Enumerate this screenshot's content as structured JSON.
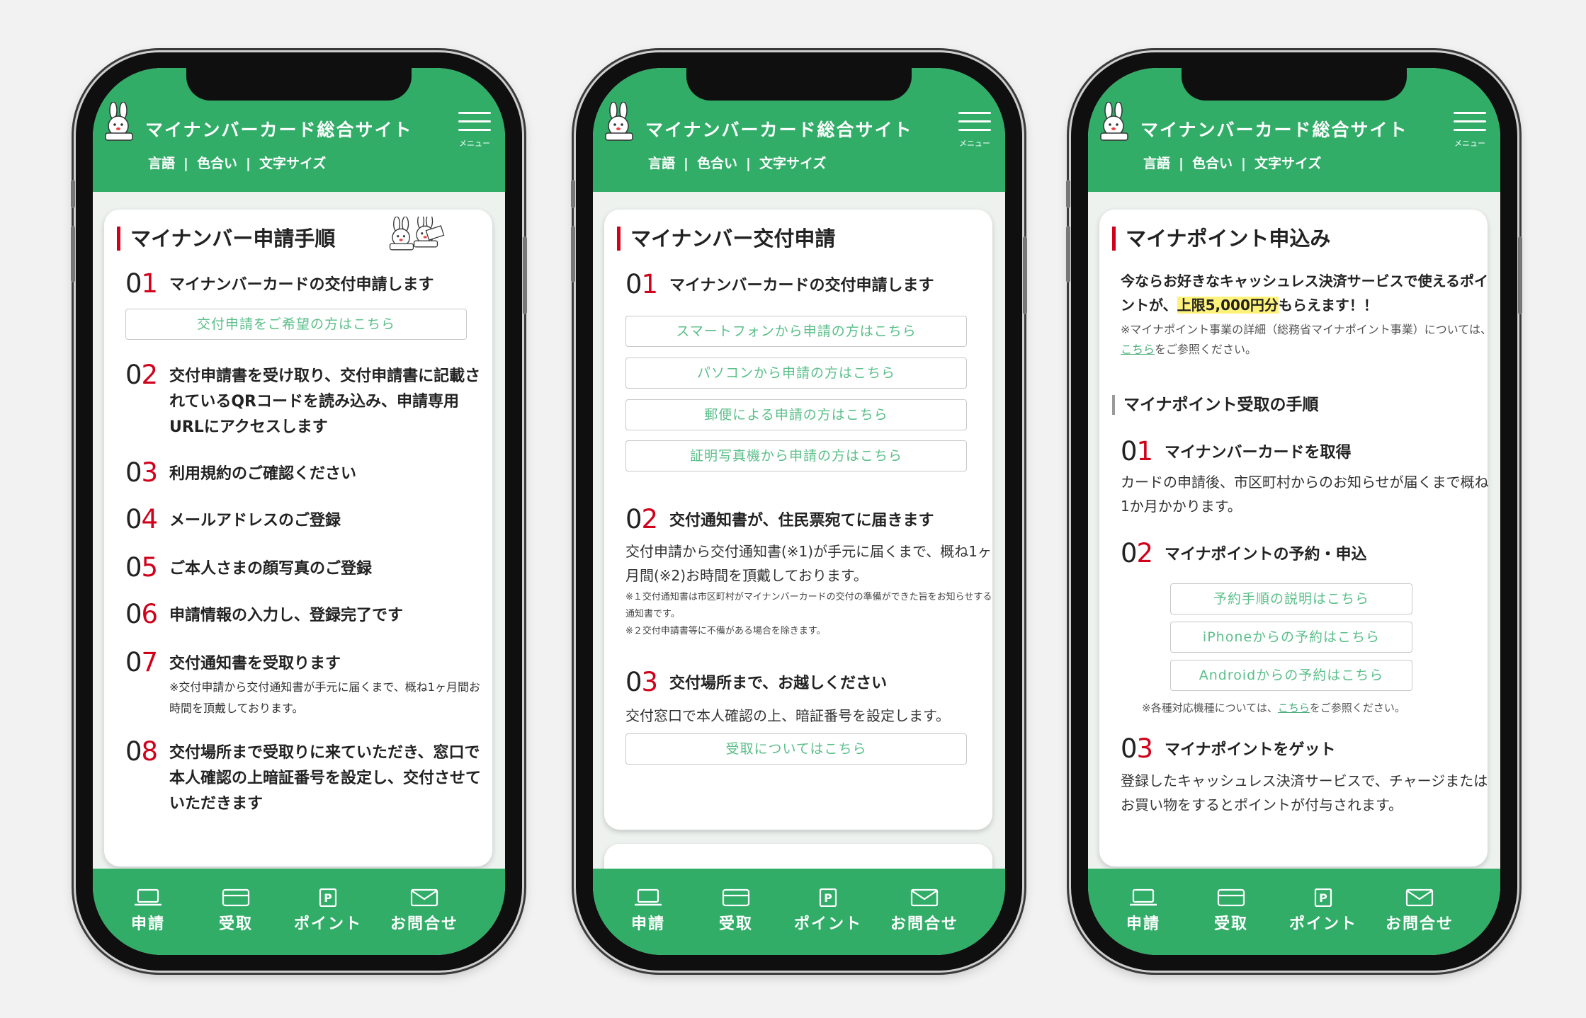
{
  "header": {
    "site_title": "マイナンバーカード総合サイト",
    "menu_label": "メニュー",
    "nav": [
      "言語",
      "色合い",
      "文字サイズ"
    ],
    "nav_sep": "|"
  },
  "bottom_nav": [
    {
      "label": "申請",
      "icon": "laptop-icon"
    },
    {
      "label": "受取",
      "icon": "card-icon"
    },
    {
      "label": "ポイント",
      "icon": "point-icon"
    },
    {
      "label": "お問合せ",
      "icon": "mail-icon"
    }
  ],
  "screen1": {
    "title": "マイナンバー申請手順",
    "steps": [
      {
        "num": "01",
        "text": "マイナンバーカードの交付申請します",
        "button": "交付申請をご希望の方はこちら"
      },
      {
        "num": "02",
        "text": "交付申請書を受け取り、交付申請書に記載されているQRコードを読み込み、申請専用URLにアクセスします"
      },
      {
        "num": "03",
        "text": "利用規約のご確認ください"
      },
      {
        "num": "04",
        "text": "メールアドレスのご登録"
      },
      {
        "num": "05",
        "text": "ご本人さまの顔写真のご登録"
      },
      {
        "num": "06",
        "text": "申請情報の入力し、登録完了です"
      },
      {
        "num": "07",
        "text": "交付通知書を受取ります",
        "note": "※交付申請から交付通知書が手元に届くまで、概ね1ヶ月間お時間を頂戴しております。"
      },
      {
        "num": "08",
        "text": "交付場所まで受取りに来ていただき、窓口で本人確認の上暗証番号を設定し、交付させていただきます"
      }
    ]
  },
  "screen2": {
    "title": "マイナンバー交付申請",
    "step1": {
      "num": "01",
      "text": "マイナンバーカードの交付申請します"
    },
    "buttons": [
      "スマートフォンから申請の方はこちら",
      "パソコンから申請の方はこちら",
      "郵便による申請の方はこちら",
      "証明写真機から申請の方はこちら"
    ],
    "step2": {
      "num": "02",
      "text": "交付通知書が、住民票宛てに届きます"
    },
    "step2_para": "交付申請から交付通知書(※1)が手元に届くまで、概ね1ヶ月間(※2)お時間を頂戴しております。",
    "step2_note1": "※１交付通知書は市区町村がマイナンバーカードの交付の準備ができた旨をお知らせする通知書です。",
    "step2_note2": "※２交付申請書等に不備がある場合を除きます。",
    "step3": {
      "num": "03",
      "text": "交付場所まで、お越しください"
    },
    "step3_para": "交付窓口で本人確認の上、暗証番号を設定します。",
    "step3_button": "受取についてはこちら"
  },
  "screen3": {
    "title": "マイナポイント申込み",
    "intro_a": "今ならお好きなキャッシュレス決済サービスで使えるポイントが、",
    "intro_highlight": "上限5,000円分",
    "intro_b": "もらえます！！",
    "detail_a": "※マイナポイント事業の詳細（総務省マイナポイント事業）については、",
    "detail_link": "こちら",
    "detail_b": "をご参照ください。",
    "subtitle": "マイナポイント受取の手順",
    "step1": {
      "num": "01",
      "text": "マイナンバーカードを取得"
    },
    "step1_para": "カードの申請後、市区町村からのお知らせが届くまで概ね1か月かかります。",
    "step2": {
      "num": "02",
      "text": "マイナポイントの予約・申込"
    },
    "buttons": [
      "予約手順の説明はこちら",
      "iPhoneからの予約はこちら",
      "Androidからの予約はこちら"
    ],
    "device_a": "※各種対応機種については、",
    "device_link": "こちら",
    "device_b": "をご参照ください。",
    "step3": {
      "num": "03",
      "text": "マイナポイントをゲット"
    },
    "step3_para": "登録したキャッシュレス決済サービスで、チャージまたはお買い物をするとポイントが付与されます。"
  },
  "colors": {
    "brand_green": "#31ad68",
    "accent_red": "#d0021b",
    "link_green": "#5bbf8a"
  }
}
